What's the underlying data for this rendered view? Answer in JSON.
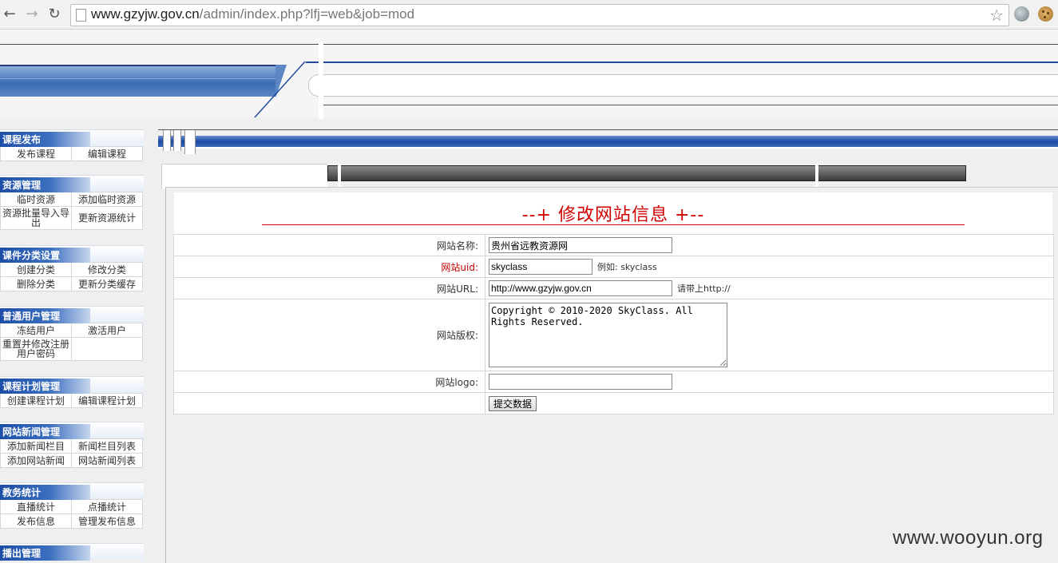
{
  "browser": {
    "url_host": "www.gzyjw.gov.cn",
    "url_path": "/admin/index.php?lfj=web&job=mod"
  },
  "sidebar": {
    "groups": [
      {
        "title": "课程发布",
        "items": [
          "发布课程",
          "编辑课程"
        ]
      },
      {
        "title": "资源管理",
        "items": [
          "临时资源",
          "添加临时资源",
          "资源批量导入导出",
          "更新资源统计"
        ]
      },
      {
        "title": "课件分类设置",
        "items": [
          "创建分类",
          "修改分类",
          "删除分类",
          "更新分类缓存"
        ]
      },
      {
        "title": "普通用户管理",
        "items": [
          "冻结用户",
          "激活用户",
          "重置并修改注册用户密码",
          ""
        ]
      },
      {
        "title": "课程计划管理",
        "items": [
          "创建课程计划",
          "编辑课程计划"
        ]
      },
      {
        "title": "网站新闻管理",
        "items": [
          "添加新闻栏目",
          "新闻栏目列表",
          "添加网站新闻",
          "网站新闻列表"
        ]
      },
      {
        "title": "教务统计",
        "items": [
          "直播统计",
          "点播统计",
          "发布信息",
          "管理发布信息"
        ]
      },
      {
        "title": "播出管理",
        "items": []
      }
    ]
  },
  "main": {
    "title": "--+ 修改网站信息 +--",
    "form": {
      "site_name_label": "网站名称:",
      "site_name_value": "贵州省远教资源网",
      "site_uid_label": "网站uid:",
      "site_uid_value": "skyclass",
      "site_uid_hint": "例如: skyclass",
      "site_url_label": "网站URL:",
      "site_url_value": "http://www.gzyjw.gov.cn",
      "site_url_hint": "请带上http://",
      "copyright_label": "网站版权:",
      "copyright_value": "Copyright © 2010-2020 SkyClass. All Rights Reserved.",
      "logo_label": "网站logo:",
      "logo_value": "",
      "submit_label": "提交数据"
    }
  },
  "watermark": "www.wooyun.org"
}
